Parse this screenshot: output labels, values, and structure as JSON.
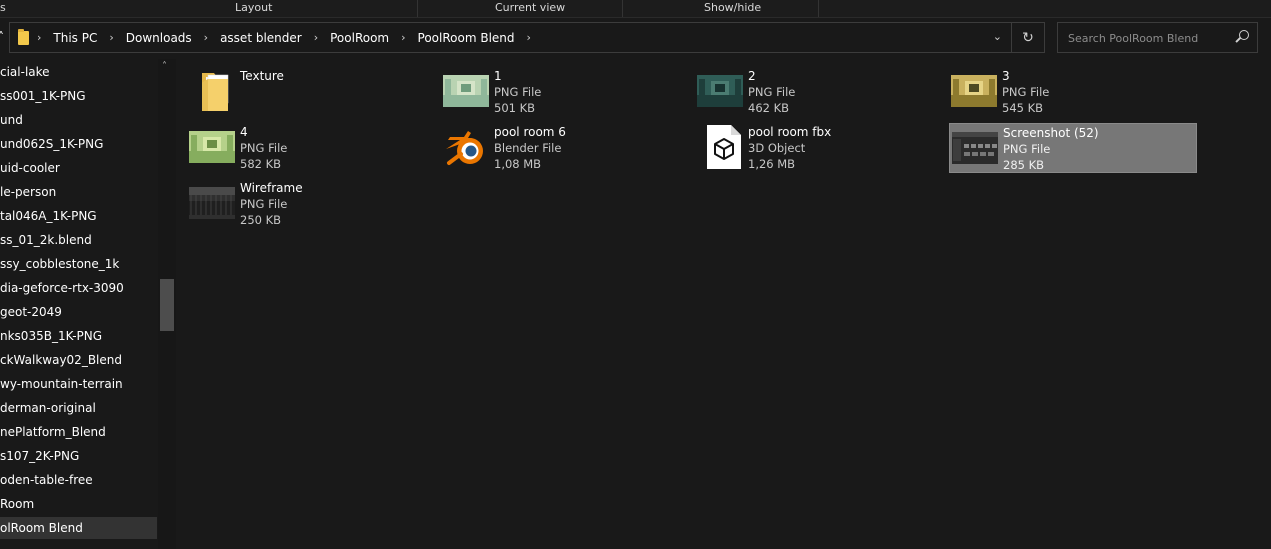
{
  "ribbon": {
    "groups": [
      "Layout",
      "Current view",
      "Show/hide"
    ]
  },
  "address": {
    "crumbs": [
      "This PC",
      "Downloads",
      "asset blender",
      "PoolRoom",
      "PoolRoom Blend"
    ]
  },
  "search": {
    "placeholder": "Search PoolRoom Blend"
  },
  "nav": {
    "items": [
      "cial-lake",
      "ss001_1K-PNG",
      "und",
      "und062S_1K-PNG",
      "uid-cooler",
      "le-person",
      "tal046A_1K-PNG",
      "ss_01_2k.blend",
      "ssy_cobblestone_1k",
      "dia-geforce-rtx-3090",
      "geot-2049",
      "nks035B_1K-PNG",
      "ckWalkway02_Blend",
      "wy-mountain-terrain",
      "derman-original",
      "nePlatform_Blend",
      "s107_2K-PNG",
      "oden-table-free",
      "Room",
      "olRoom Blend"
    ],
    "selected_index": 19
  },
  "files": [
    {
      "name": "Texture",
      "type": "",
      "size": "",
      "icon": "folder-icon"
    },
    {
      "name": "1",
      "type": "PNG File",
      "size": "501 KB",
      "icon": "png-thumbnail"
    },
    {
      "name": "2",
      "type": "PNG File",
      "size": "462 KB",
      "icon": "png-thumbnail"
    },
    {
      "name": "3",
      "type": "PNG File",
      "size": "545 KB",
      "icon": "png-thumbnail"
    },
    {
      "name": "4",
      "type": "PNG File",
      "size": "582 KB",
      "icon": "png-thumbnail"
    },
    {
      "name": "pool room 6",
      "type": "Blender File",
      "size": "1,08 MB",
      "icon": "blender-icon"
    },
    {
      "name": "pool room fbx",
      "type": "3D Object",
      "size": "1,26 MB",
      "icon": "3d-object-icon"
    },
    {
      "name": "Screenshot (52)",
      "type": "PNG File",
      "size": "285 KB",
      "icon": "png-thumbnail"
    },
    {
      "name": "Wireframe",
      "type": "PNG File",
      "size": "250 KB",
      "icon": "png-thumbnail"
    }
  ],
  "selected_file": "Screenshot (52)",
  "colors": {
    "background": "#191919",
    "selection": "#777777",
    "nav_selection": "#333333",
    "folder": "#f2c84b",
    "blender_orange": "#ea7600",
    "blender_blue": "#265787"
  }
}
